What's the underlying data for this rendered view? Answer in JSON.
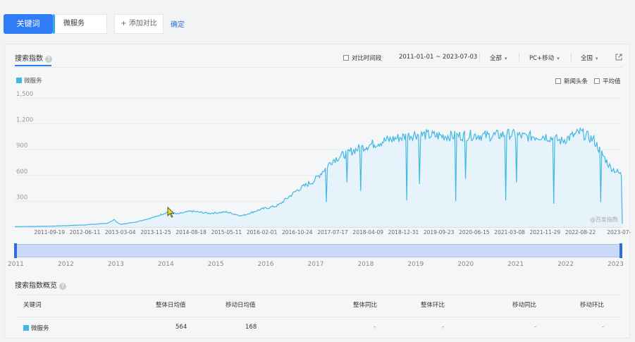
{
  "toolbar": {
    "keyword_tab": "关键词",
    "keyword_value": "微服务",
    "add_compare": "+ 添加对比",
    "confirm": "确定"
  },
  "panel": {
    "title": "搜索指数",
    "help_icon": "question-icon",
    "compare_period": "对比时间段",
    "date_range": "2011-01-01 ~ 2023-07-03",
    "source_filter": "全部",
    "device_filter": "PC+移动",
    "region_filter": "全国",
    "export_icon": "external-link-icon",
    "news_headline": "新闻头条",
    "average": "平均值",
    "watermark": "@百度指数"
  },
  "chart_data": {
    "type": "area",
    "series": [
      {
        "name": "微服务",
        "color": "#41b8e3",
        "points": [
          [
            "2011-01-01",
            5
          ],
          [
            "2011-09-19",
            10
          ],
          [
            "2012-06-11",
            25
          ],
          [
            "2012-12-01",
            45
          ],
          [
            "2013-01-15",
            85
          ],
          [
            "2013-03-04",
            30
          ],
          [
            "2013-07-01",
            60
          ],
          [
            "2013-11-25",
            120
          ],
          [
            "2014-03-01",
            180
          ],
          [
            "2014-05-01",
            150
          ],
          [
            "2014-08-18",
            185
          ],
          [
            "2015-01-01",
            160
          ],
          [
            "2015-05-11",
            175
          ],
          [
            "2015-09-01",
            130
          ],
          [
            "2016-02-01",
            210
          ],
          [
            "2016-06-01",
            250
          ],
          [
            "2016-10-24",
            430
          ],
          [
            "2017-03-01",
            540
          ],
          [
            "2017-07-17",
            780
          ],
          [
            "2017-12-01",
            880
          ],
          [
            "2018-04-09",
            950
          ],
          [
            "2018-08-01",
            1000
          ],
          [
            "2018-12-31",
            1050
          ],
          [
            "2019-04-01",
            1080
          ],
          [
            "2019-09-23",
            1060
          ],
          [
            "2020-02-01",
            1060
          ],
          [
            "2020-06-15",
            1070
          ],
          [
            "2020-10-01",
            1060
          ],
          [
            "2021-03-08",
            1080
          ],
          [
            "2021-07-01",
            1050
          ],
          [
            "2021-11-29",
            1060
          ],
          [
            "2022-04-01",
            1000
          ],
          [
            "2022-08-22",
            1100
          ],
          [
            "2022-12-01",
            1010
          ],
          [
            "2023-04-01",
            700
          ],
          [
            "2023-07-03",
            600
          ]
        ],
        "dips": [
          [
            "2017-06-01",
            290
          ],
          [
            "2017-11-01",
            520
          ],
          [
            "2018-02-10",
            420
          ],
          [
            "2019-01-25",
            310
          ],
          [
            "2019-05-01",
            500
          ],
          [
            "2020-01-25",
            300
          ],
          [
            "2020-04-10",
            560
          ],
          [
            "2021-02-10",
            310
          ],
          [
            "2021-05-01",
            520
          ],
          [
            "2022-01-30",
            270
          ],
          [
            "2023-01-22",
            290
          ],
          [
            "2023-07-03",
            40
          ]
        ]
      }
    ],
    "x_ticks": [
      "2011-09-19",
      "2012-06-11",
      "2013-03-04",
      "2013-11-25",
      "2014-08-18",
      "2015-05-11",
      "2016-02-01",
      "2016-10-24",
      "2017-07-17",
      "2018-04-09",
      "2018-12-31",
      "2019-09-23",
      "2020-06-15",
      "2021-03-08",
      "2021-11-29",
      "2022-08-22",
      "2023-07-03"
    ],
    "y_ticks": [
      "300",
      "600",
      "900",
      "1,200",
      "1,500"
    ],
    "ylim": [
      0,
      1500
    ],
    "xlim": [
      "2011-01-01",
      "2023-07-03"
    ],
    "grid": true,
    "legend": "top-left"
  },
  "range_slider": {
    "years": [
      "2011",
      "2012",
      "2013",
      "2014",
      "2015",
      "2016",
      "2017",
      "2018",
      "2019",
      "2020",
      "2021",
      "2022",
      "2023"
    ]
  },
  "overview": {
    "title": "搜索指数概览",
    "columns": [
      "关键词",
      "整体日均值",
      "移动日均值",
      "整体同比",
      "整体环比",
      "移动同比",
      "移动环比"
    ],
    "row": {
      "keyword": "微服务",
      "overall_avg": "564",
      "mobile_avg": "168",
      "overall_yoy": "-",
      "overall_mom": "-",
      "mobile_yoy": "-",
      "mobile_mom": "-"
    }
  }
}
